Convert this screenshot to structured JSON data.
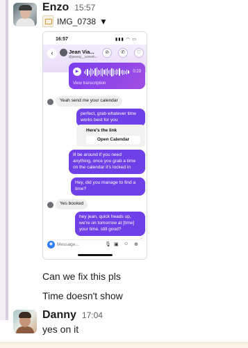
{
  "messages": {
    "enzo": {
      "sender": "Enzo",
      "time": "15:57",
      "file_name": "IMG_0738",
      "caret": "▼",
      "texts": [
        "Can we fix this pls",
        "Time doesn't show"
      ]
    },
    "danny": {
      "sender": "Danny",
      "time": "17:04",
      "text": "yes on it"
    }
  },
  "phone": {
    "status_time": "16:57",
    "status_icons": "▮▮▮ ◠ ▭",
    "contact_name": "Jean Via...",
    "contact_handle": "@jeanay__someth...",
    "back_glyph": "‹",
    "header_icons": [
      "link-icon",
      "phone-icon",
      "heart-icon"
    ],
    "header_glyphs": [
      "⊘",
      "✆",
      "♡"
    ],
    "voice": {
      "duration": "0:23",
      "transcript_label": "View transcription",
      "play_glyph": "▶"
    },
    "chat": [
      {
        "side": "recv",
        "text": "Yeah send me your calendar"
      },
      {
        "side": "sent",
        "text": "perfect, grab whatever time works best for you"
      },
      {
        "side": "sent",
        "text": "ill be around if you need anything, once you grab a time on the calendar it's locked in"
      },
      {
        "side": "sent",
        "text": "Hey, did you manage to find a time?"
      },
      {
        "side": "recv",
        "text": "Yes booked"
      },
      {
        "side": "sent",
        "text": "hey jean, quick heads up, we're on tomorrow at [time] your time. still good?"
      }
    ],
    "link_card": {
      "title": "Here's the link",
      "button_label": "Open Calendar"
    },
    "composer": {
      "placeholder": "Message...",
      "camera_glyph": "◉",
      "icons": [
        "mic-icon",
        "image-icon",
        "sticker-icon",
        "plus-icon"
      ],
      "icon_glyphs": [
        "🎙",
        "▣",
        "☺",
        "⊕"
      ]
    }
  },
  "colors": {
    "sent_bubble": "#6f3fe8",
    "voice_gradient_start": "#7a3df0",
    "voice_gradient_end": "#a14ee0",
    "received_bubble": "#eeeeef",
    "camera_button": "#2f7cf6"
  }
}
